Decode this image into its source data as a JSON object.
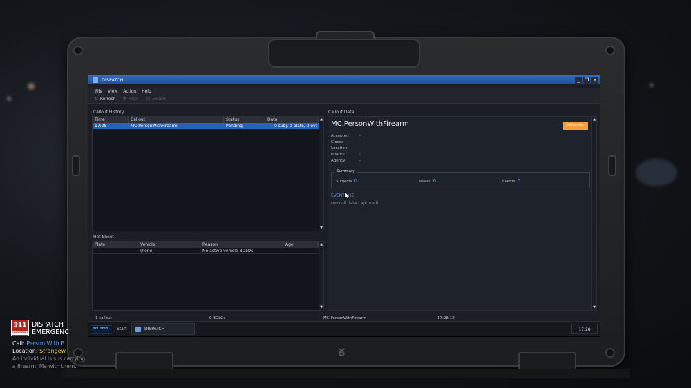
{
  "window": {
    "title": "DISPATCH",
    "controls": [
      "_",
      "❐",
      "✕"
    ]
  },
  "menu": [
    "File",
    "View",
    "Action",
    "Help"
  ],
  "toolbar": {
    "refresh": "Refresh",
    "filter": "Filter",
    "export": "Export"
  },
  "callout_history": {
    "label": "Callout History",
    "columns": [
      "Time",
      "Callout",
      "Status",
      "Data"
    ],
    "rows": [
      {
        "time": "17:28",
        "callout": "MC.PersonWithFirearm",
        "status": "Pending",
        "data": "0 subj, 0 plate, 0 evt"
      }
    ]
  },
  "hot_sheet": {
    "label": "Hot Sheet",
    "columns": [
      "Plate",
      "Vehicle",
      "Reason",
      "Age"
    ],
    "rows": [
      {
        "plate": "-",
        "vehicle": "(none)",
        "reason": "No active vehicle BOLOs.",
        "age": ""
      }
    ]
  },
  "callout_data": {
    "label": "Callout Data",
    "title": "MC.PersonWithFirearm",
    "status": "PENDING",
    "fields": [
      {
        "key": "Accepted",
        "value": "-"
      },
      {
        "key": "Closed",
        "value": "-"
      },
      {
        "key": "Location",
        "value": "-"
      },
      {
        "key": "Priority",
        "value": "-"
      },
      {
        "key": "Agency",
        "value": "-"
      }
    ],
    "summary": {
      "legend": "Summary",
      "subjects_label": "Subjects",
      "subjects": "0",
      "plates_label": "Plates",
      "plates": "0",
      "events_label": "Events",
      "events": "0"
    },
    "event_log_label": "EVENT LOG",
    "event_log_empty": "(no call data captured)"
  },
  "statusbar": {
    "callouts": "1 callout",
    "bolos": "0 BOLOs",
    "current": "MC.PersonWithFirearm",
    "time": "17:28:18"
  },
  "taskbar": {
    "logo": "pcComp",
    "start": "Start",
    "task": "DISPATCH",
    "clock": "17:28"
  },
  "notification": {
    "badge": "911",
    "badge_sub": "EMERGENCY",
    "title_line1": "DISPATCH",
    "title_line2": "EMERGENC",
    "call_label": "Call:",
    "call_value": "Person With F",
    "location_label": "Location:",
    "location_value": "Strangew",
    "description": "An individual is sus carrying a firearm. Ma with them."
  },
  "colors": {
    "accent": "#2464b8",
    "status_pending": "#f0a03a",
    "link": "#5b9cf0",
    "badge_red": "#b3241f"
  }
}
